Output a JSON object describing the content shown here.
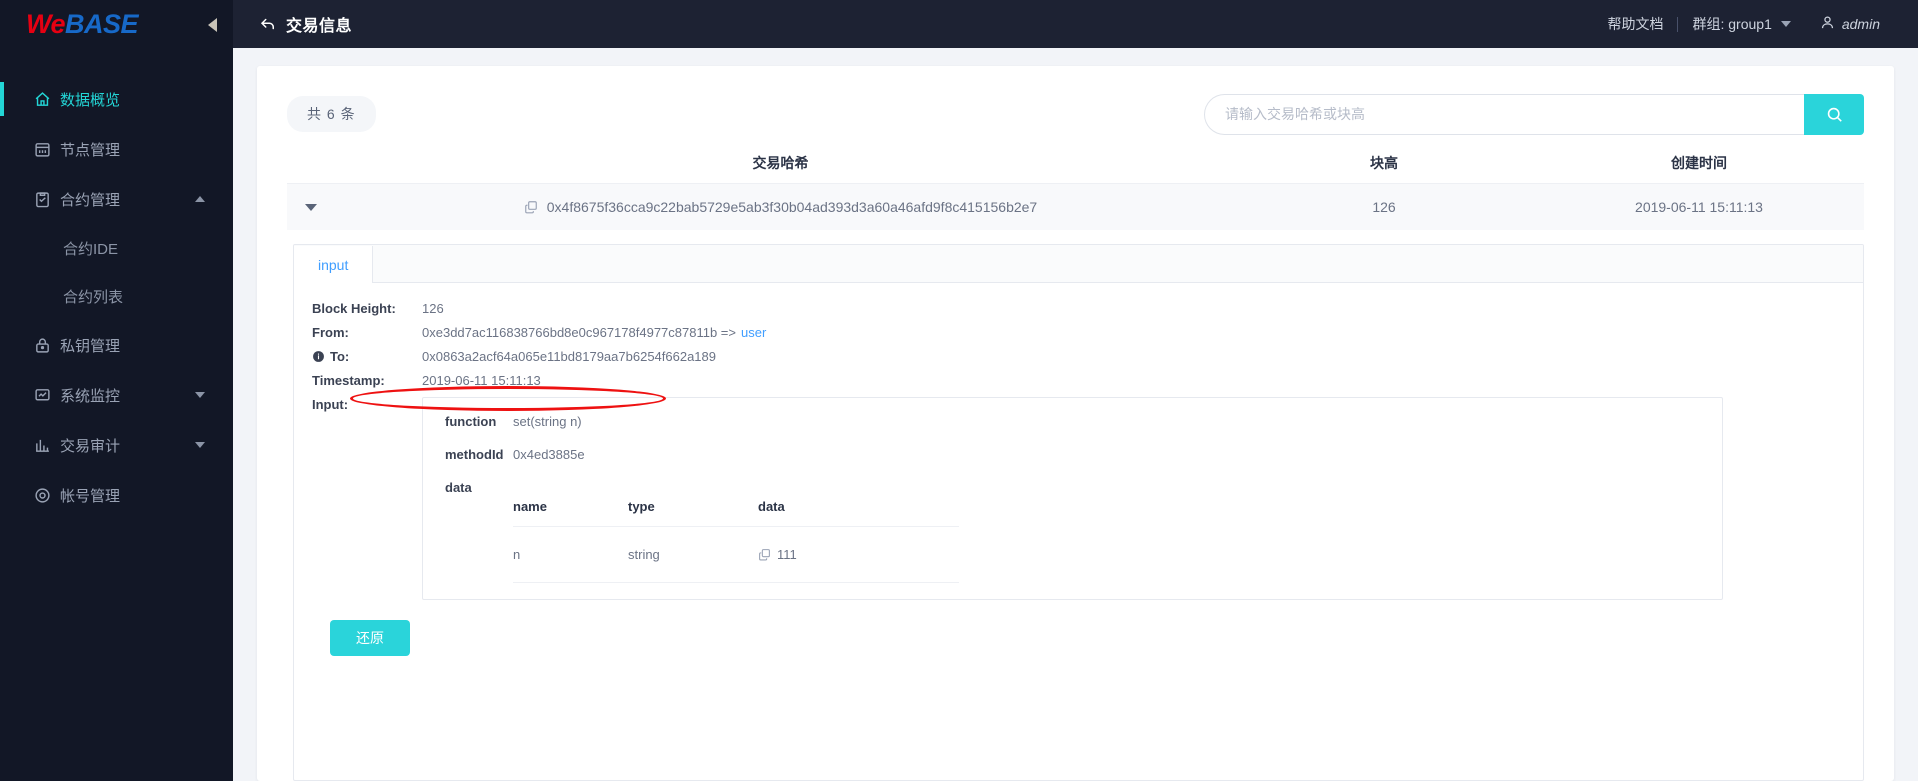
{
  "brand": {
    "part1": "We",
    "part2": "BASE",
    "color1": "#e60012",
    "color2": "#1769c8"
  },
  "sidebar": {
    "items": [
      {
        "label": "数据概览",
        "icon": "home-icon",
        "active": true
      },
      {
        "label": "节点管理",
        "icon": "node-icon",
        "active": false
      },
      {
        "label": "合约管理",
        "icon": "clipboard-icon",
        "active": false,
        "expanded": true
      },
      {
        "label": "合约IDE",
        "sub": true
      },
      {
        "label": "合约列表",
        "sub": true
      },
      {
        "label": "私钥管理",
        "icon": "lock-icon",
        "active": false
      },
      {
        "label": "系统监控",
        "icon": "monitor-icon",
        "active": false,
        "collapsed": true
      },
      {
        "label": "交易审计",
        "icon": "chart-icon",
        "active": false,
        "collapsed": true
      },
      {
        "label": "帐号管理",
        "icon": "account-icon",
        "active": false
      }
    ]
  },
  "topbar": {
    "title": "交易信息",
    "back_icon": "back-arrow-icon",
    "help_label": "帮助文档",
    "group_label": "群组: group1",
    "user_label": "admin"
  },
  "toolbar": {
    "count_badge": "共 6 条",
    "search_placeholder": "请输入交易哈希或块高",
    "search_value": "",
    "search_button_color": "#2ad4da"
  },
  "table": {
    "headers": {
      "hash": "交易哈希",
      "block": "块高",
      "time": "创建时间"
    },
    "rows": [
      {
        "hash": "0x4f8675f36cca9c22bab5729e5ab3f30b04ad393d3a60a46afd9f8c415156b2e7",
        "block": "126",
        "time": "2019-06-11 15:11:13"
      }
    ]
  },
  "detail": {
    "tab_label": "input",
    "block_height_key": "Block Height:",
    "block_height_val": "126",
    "from_key": "From:",
    "from_val": "0xe3dd7ac116838766bd8e0c967178f4977c87811b =>",
    "from_link": "user",
    "to_key": "To:",
    "to_val": "0x0863a2acf64a065e11bd8179aa7b6254f662a189",
    "timestamp_key": "Timestamp:",
    "timestamp_val": "2019-06-11 15:11:13",
    "input_key": "Input:",
    "function_key": "function",
    "function_val": "set(string n)",
    "methodid_key": "methodId",
    "methodid_val": "0x4ed3885e",
    "data_key": "data",
    "data_headers": {
      "name": "name",
      "type": "type",
      "data": "data"
    },
    "data_rows": [
      {
        "name": "n",
        "type": "string",
        "data": "111"
      }
    ],
    "restore_label": "还原"
  }
}
